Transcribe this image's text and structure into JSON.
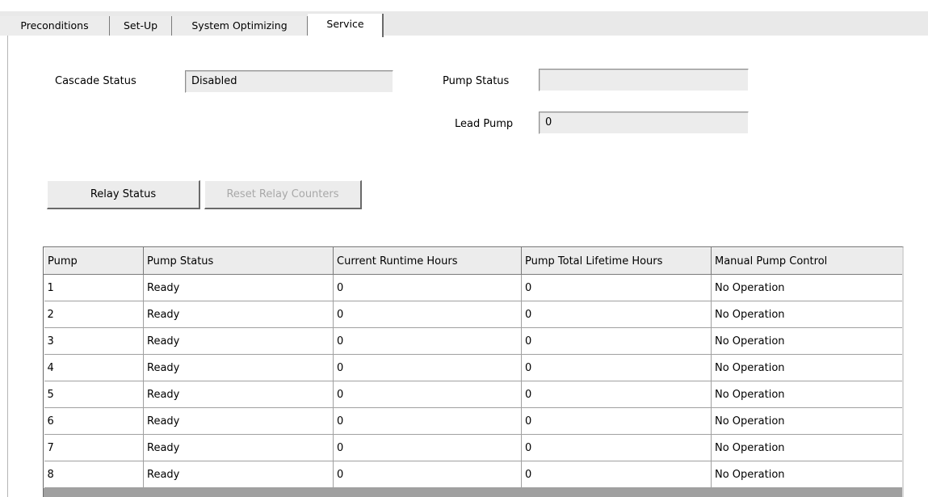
{
  "tabs": [
    {
      "label": "Preconditions",
      "active": false
    },
    {
      "label": "Set-Up",
      "active": false
    },
    {
      "label": "System Optimizing",
      "active": false
    },
    {
      "label": "Service",
      "active": true
    }
  ],
  "fields": {
    "cascade_status": {
      "label": "Cascade Status",
      "value": "Disabled"
    },
    "pump_status": {
      "label": "Pump Status",
      "value": ""
    },
    "lead_pump": {
      "label": "Lead Pump",
      "value": "0"
    }
  },
  "buttons": {
    "relay_status": {
      "label": "Relay Status",
      "enabled": true
    },
    "reset_relay_counters": {
      "label": "Reset Relay Counters",
      "enabled": false
    }
  },
  "table": {
    "columns": [
      "Pump",
      "Pump Status",
      "Current Runtime Hours",
      "Pump Total Lifetime Hours",
      "Manual Pump Control"
    ],
    "rows": [
      [
        "1",
        "Ready",
        "0",
        "0",
        "No Operation"
      ],
      [
        "2",
        "Ready",
        "0",
        "0",
        "No Operation"
      ],
      [
        "3",
        "Ready",
        "0",
        "0",
        "No Operation"
      ],
      [
        "4",
        "Ready",
        "0",
        "0",
        "No Operation"
      ],
      [
        "5",
        "Ready",
        "0",
        "0",
        "No Operation"
      ],
      [
        "6",
        "Ready",
        "0",
        "0",
        "No Operation"
      ],
      [
        "7",
        "Ready",
        "0",
        "0",
        "No Operation"
      ],
      [
        "8",
        "Ready",
        "0",
        "0",
        "No Operation"
      ]
    ]
  },
  "colors": {
    "panel": "#ececec",
    "grid_background": "#a0a0a0",
    "disabled_text": "#a8a8a8"
  }
}
